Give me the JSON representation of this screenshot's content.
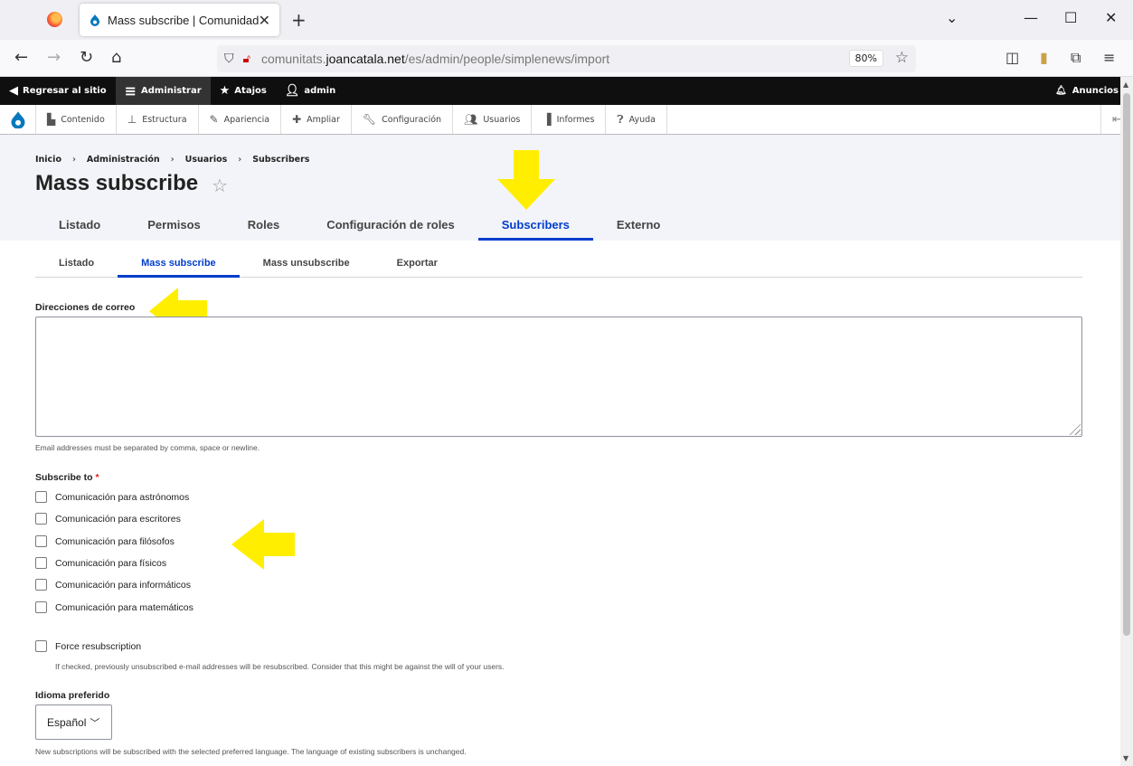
{
  "browser": {
    "tab_title": "Mass subscribe | Comunidades",
    "url_prefix": "comunitats.",
    "url_domain": "joancatala.net",
    "url_path": "/es/admin/people/simplenews/import",
    "zoom": "80%"
  },
  "toolbar": {
    "back_site": "Regresar al sitio",
    "manage": "Administrar",
    "shortcuts": "Atajos",
    "user": "admin",
    "announcements": "Anuncios"
  },
  "tray": {
    "items": [
      "Contenido",
      "Estructura",
      "Apariencia",
      "Ampliar",
      "Configuración",
      "Usuarios",
      "Informes",
      "Ayuda"
    ]
  },
  "breadcrumb": [
    "Inicio",
    "Administración",
    "Usuarios",
    "Subscribers"
  ],
  "page_title": "Mass subscribe",
  "primary_tabs": [
    "Listado",
    "Permisos",
    "Roles",
    "Configuración de roles",
    "Subscribers",
    "Externo"
  ],
  "secondary_tabs": [
    "Listado",
    "Mass subscribe",
    "Mass unsubscribe",
    "Exportar"
  ],
  "form": {
    "emails_label": "Direcciones de correo",
    "emails_value": "",
    "emails_desc": "Email addresses must be separated by comma, space or newline.",
    "subscribe_label": "Subscribe to",
    "required_mark": "*",
    "newsletters": [
      "Comunicación para astrónomos",
      "Comunicación para escritores",
      "Comunicación para filósofos",
      "Comunicación para físicos",
      "Comunicación para informáticos",
      "Comunicación para matemáticos"
    ],
    "force_label": "Force resubscription",
    "force_desc": "If checked, previously unsubscribed e-mail addresses will be resubscribed. Consider that this might be against the will of your users.",
    "language_label": "Idioma preferido",
    "language_value": "Español",
    "language_desc": "New subscriptions will be subscribed with the selected preferred language. The language of existing subscribers is unchanged."
  },
  "colors": {
    "accent": "#003ecc",
    "arrow": "#ffee00"
  }
}
